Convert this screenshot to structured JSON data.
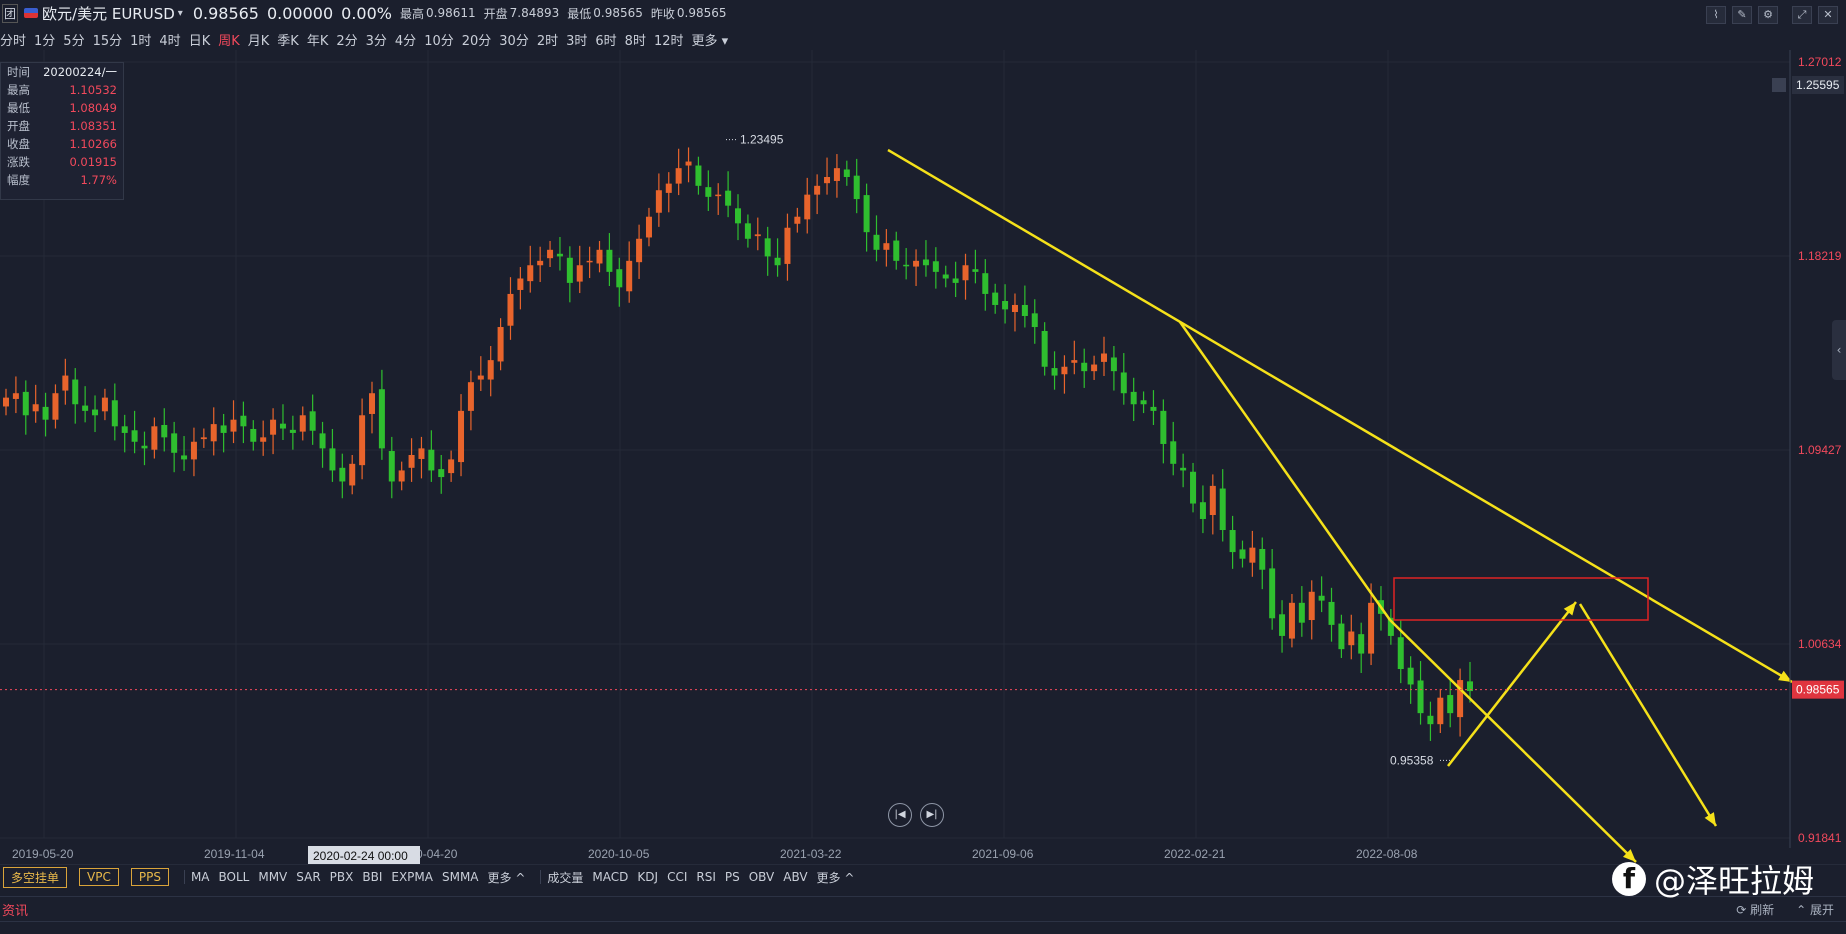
{
  "header": {
    "left_icon": "团",
    "symbol": "欧元/美元 EURUSD",
    "price": "0.98565",
    "change": "0.00000",
    "change_pct": "0.00%",
    "high_label": "最高",
    "high": "0.98611",
    "open_label": "开盘",
    "open": "7.84893",
    "low_label": "最低",
    "low": "0.98565",
    "prev_label": "昨收",
    "prev": "0.98565"
  },
  "timeframes": [
    "分时",
    "1分",
    "5分",
    "15分",
    "1时",
    "4时",
    "日K",
    "周K",
    "月K",
    "季K",
    "年K",
    "2分",
    "3分",
    "4分",
    "10分",
    "20分",
    "30分",
    "2时",
    "3时",
    "6时",
    "8时",
    "12时",
    "更多"
  ],
  "active_timeframe": "周K",
  "infobox": {
    "rows": [
      {
        "k": "时间",
        "v": "20200224/一",
        "color": "white"
      },
      {
        "k": "最高",
        "v": "1.10532",
        "color": "red"
      },
      {
        "k": "最低",
        "v": "1.08049",
        "color": "red"
      },
      {
        "k": "开盘",
        "v": "1.08351",
        "color": "red"
      },
      {
        "k": "收盘",
        "v": "1.10266",
        "color": "red"
      },
      {
        "k": "涨跌",
        "v": "0.01915",
        "color": "red"
      },
      {
        "k": "幅度",
        "v": "1.77%",
        "color": "red"
      }
    ]
  },
  "bottom_toolbar": {
    "pills": [
      "多空挂单",
      "VPC",
      "PPS"
    ],
    "main_indicators": [
      "MA",
      "BOLL",
      "MMV",
      "SAR",
      "PBX",
      "BBI",
      "EXPMA",
      "SMMA",
      "更多 ^"
    ],
    "sub_indicators": [
      "成交量",
      "MACD",
      "KDJ",
      "CCI",
      "RSI",
      "PS",
      "OBV",
      "ABV",
      "更多 ^"
    ]
  },
  "news": {
    "title": "资讯",
    "refresh": "刷新",
    "expand": "展开"
  },
  "watermark": "@泽旺拉姆",
  "chart_data": {
    "type": "candlestick",
    "title": "欧元/美元 EURUSD 周K",
    "y_ticks": [
      "1.27012",
      "1.18219",
      "1.09427",
      "1.00634",
      "0.91841"
    ],
    "ylim": [
      0.91841,
      1.27012
    ],
    "current_price_tag": "0.98565",
    "top_right_tag": "1.25595",
    "x_ticks": [
      "2019-05-20",
      "2019-11-04",
      "2020-04-20",
      "2020-10-05",
      "2021-03-22",
      "2021-09-06",
      "2022-02-21",
      "2022-08-08"
    ],
    "x_crosshair_label": "2020-02-24 00:00",
    "annotations": {
      "high": "1.23495",
      "low": "0.95358"
    },
    "up_color": "#e8642c",
    "down_color": "#2fbf2f",
    "line_color": "#f5e11a",
    "box_color": "#e02424",
    "closes": [
      1.118,
      1.12,
      1.11,
      1.115,
      1.108,
      1.12,
      1.128,
      1.115,
      1.112,
      1.11,
      1.118,
      1.105,
      1.102,
      1.098,
      1.095,
      1.105,
      1.1,
      1.093,
      1.09,
      1.098,
      1.1,
      1.106,
      1.102,
      1.108,
      1.105,
      1.098,
      1.1,
      1.108,
      1.104,
      1.102,
      1.11,
      1.103,
      1.095,
      1.085,
      1.08,
      1.088,
      1.11,
      1.12,
      1.095,
      1.08,
      1.085,
      1.092,
      1.095,
      1.085,
      1.082,
      1.09,
      1.112,
      1.125,
      1.128,
      1.135,
      1.15,
      1.165,
      1.172,
      1.178,
      1.18,
      1.185,
      1.182,
      1.17,
      1.178,
      1.18,
      1.185,
      1.175,
      1.168,
      1.18,
      1.19,
      1.2,
      1.212,
      1.215,
      1.222,
      1.225,
      1.214,
      1.209,
      1.21,
      1.205,
      1.197,
      1.19,
      1.192,
      1.182,
      1.178,
      1.195,
      1.2,
      1.21,
      1.214,
      1.218,
      1.222,
      1.218,
      1.208,
      1.193,
      1.185,
      1.188,
      1.18,
      1.178,
      1.18,
      1.178,
      1.175,
      1.172,
      1.17,
      1.178,
      1.175,
      1.165,
      1.16,
      1.158,
      1.16,
      1.155,
      1.15,
      1.132,
      1.128,
      1.132,
      1.135,
      1.13,
      1.133,
      1.138,
      1.13,
      1.12,
      1.115,
      1.115,
      1.112,
      1.097,
      1.088,
      1.085,
      1.07,
      1.063,
      1.078,
      1.058,
      1.048,
      1.045,
      1.05,
      1.04,
      1.018,
      1.01,
      1.025,
      1.016,
      1.03,
      1.026,
      1.015,
      1.004,
      1.012,
      1.002,
      1.025,
      1.02,
      1.01,
      0.995,
      0.988,
      0.975,
      0.97,
      0.982,
      0.975,
      0.99,
      0.985
    ]
  }
}
